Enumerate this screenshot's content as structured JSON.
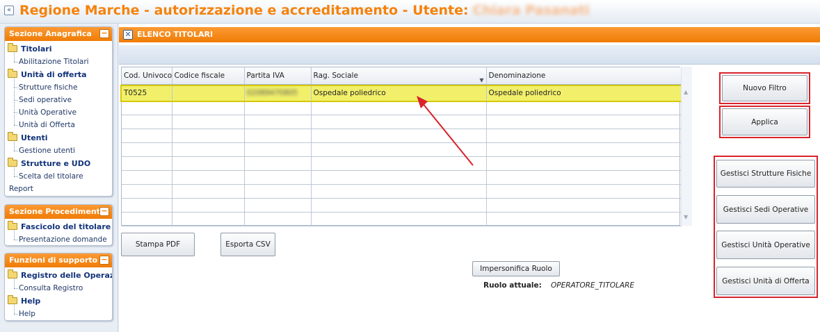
{
  "header": {
    "title": "Regione Marche - autorizzazione e accreditamento - Utente:",
    "user_name": "Chiara Pasanati",
    "collapse_glyph": "«"
  },
  "sidebar": {
    "sections": [
      {
        "title": "Sezione Anagrafica",
        "groups": [
          {
            "label": "Titolari",
            "items": [
              "Abilitazione Titolari"
            ]
          },
          {
            "label": "Unità di offerta",
            "items": [
              "Strutture fisiche",
              "Sedi operative",
              "Unità Operative",
              "Unità di Offerta"
            ]
          },
          {
            "label": "Utenti",
            "items": [
              "Gestione utenti"
            ]
          },
          {
            "label": "Strutture e UDO",
            "items": [
              "Scelta del titolare"
            ]
          }
        ],
        "root_items": [
          "Report"
        ]
      },
      {
        "title": "Sezione Procedimenti",
        "groups": [
          {
            "label": "Fascicolo del titolare",
            "items": [
              "Presentazione domande"
            ]
          }
        ]
      },
      {
        "title": "Funzioni di supporto",
        "groups": [
          {
            "label": "Registro delle Operazioni",
            "items": [
              "Consulta Registro"
            ]
          },
          {
            "label": "Help",
            "items": [
              "Help"
            ]
          }
        ]
      }
    ],
    "toggle_glyph": "−"
  },
  "main": {
    "title": "ELENCO TITOLARI",
    "close_glyph": "✕",
    "grid": {
      "columns": [
        "Cod. Univoco",
        "Codice fiscale",
        "Partita IVA",
        "Rag. Sociale",
        "Denominazione"
      ],
      "sorted_column_index": 3,
      "rows": [
        {
          "cod_univoco": "T0525",
          "codice_fiscale": "",
          "partita_iva": "02089470805",
          "rag_sociale": "Ospedale poliedrico",
          "denominazione": "Ospedale poliedrico",
          "selected": true
        }
      ],
      "empty_rows": 9
    },
    "buttons": {
      "stampa_pdf": "Stampa PDF",
      "esporta_csv": "Esporta CSV",
      "impersonifica": "Impersonifica Ruolo",
      "nuovo_filtro": "Nuovo Filtro",
      "applica": "Applica",
      "gestisci_strutture": "Gestisci Strutture Fisiche",
      "gestisci_sedi": "Gestisci Sedi Operative",
      "gestisci_unita_operative": "Gestisci Unità Operative",
      "gestisci_unita_offerta": "Gestisci Unità di Offerta"
    },
    "ruolo": {
      "label": "Ruolo attuale:",
      "value": "OPERATORE_TITOLARE"
    }
  },
  "colors": {
    "accent_orange": "#f07c05",
    "selection_yellow": "#f2f06a",
    "annotation_red": "#d9222a"
  }
}
